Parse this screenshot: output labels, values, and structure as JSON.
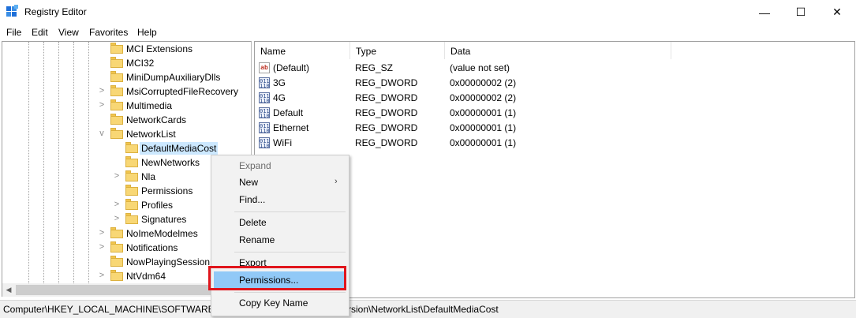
{
  "window": {
    "title": "Registry Editor",
    "minimize_glyph": "—",
    "maximize_glyph": "☐",
    "close_glyph": "✕"
  },
  "menu": [
    "File",
    "Edit",
    "View",
    "Favorites",
    "Help"
  ],
  "tree": {
    "items": [
      {
        "label": "MCI Extensions",
        "expander": ""
      },
      {
        "label": "MCI32",
        "expander": ""
      },
      {
        "label": "MiniDumpAuxiliaryDlls",
        "expander": ""
      },
      {
        "label": "MsiCorruptedFileRecovery",
        "expander": ">"
      },
      {
        "label": "Multimedia",
        "expander": ">"
      },
      {
        "label": "NetworkCards",
        "expander": ""
      },
      {
        "label": "NetworkList",
        "expander": "v"
      },
      {
        "label": "DefaultMediaCost",
        "expander": "",
        "selected": true
      },
      {
        "label": "NewNetworks",
        "expander": ""
      },
      {
        "label": "Nla",
        "expander": ">"
      },
      {
        "label": "Permissions",
        "expander": ""
      },
      {
        "label": "Profiles",
        "expander": ">"
      },
      {
        "label": "Signatures",
        "expander": ">"
      },
      {
        "label": "NoImeModelmes",
        "expander": ">"
      },
      {
        "label": "Notifications",
        "expander": ">"
      },
      {
        "label": "NowPlayingSessionM",
        "expander": ""
      },
      {
        "label": "NtVdm64",
        "expander": ">"
      }
    ],
    "scroll_left": "◀"
  },
  "list": {
    "columns": [
      "Name",
      "Type",
      "Data"
    ],
    "rows": [
      {
        "icon": "string-value-icon",
        "icon_text": "ab",
        "name": "(Default)",
        "type": "REG_SZ",
        "data": "(value not set)"
      },
      {
        "icon": "dword-value-icon",
        "icon_text": "011 110",
        "name": "3G",
        "type": "REG_DWORD",
        "data": "0x00000002 (2)"
      },
      {
        "icon": "dword-value-icon",
        "icon_text": "011 110",
        "name": "4G",
        "type": "REG_DWORD",
        "data": "0x00000002 (2)"
      },
      {
        "icon": "dword-value-icon",
        "icon_text": "011 110",
        "name": "Default",
        "type": "REG_DWORD",
        "data": "0x00000001 (1)"
      },
      {
        "icon": "dword-value-icon",
        "icon_text": "011 110",
        "name": "Ethernet",
        "type": "REG_DWORD",
        "data": "0x00000001 (1)"
      },
      {
        "icon": "dword-value-icon",
        "icon_text": "011 110",
        "name": "WiFi",
        "type": "REG_DWORD",
        "data": "0x00000001 (1)"
      }
    ]
  },
  "context_menu": {
    "expand": "Expand",
    "new": "New",
    "new_arrow": "›",
    "find": "Find...",
    "delete": "Delete",
    "rename": "Rename",
    "export": "Export",
    "permissions": "Permissions...",
    "copy_key_name": "Copy Key Name"
  },
  "status": {
    "path_left": "Computer\\HKEY_LOCAL_MACHINE\\SOFTWARE\\M",
    "path_right": "rsion\\NetworkList\\DefaultMediaCost"
  },
  "colors": {
    "selection": "#cce8ff",
    "menu_highlight": "#91c9f7",
    "annotation_red": "#e0151c",
    "folder": "#f8d775"
  }
}
